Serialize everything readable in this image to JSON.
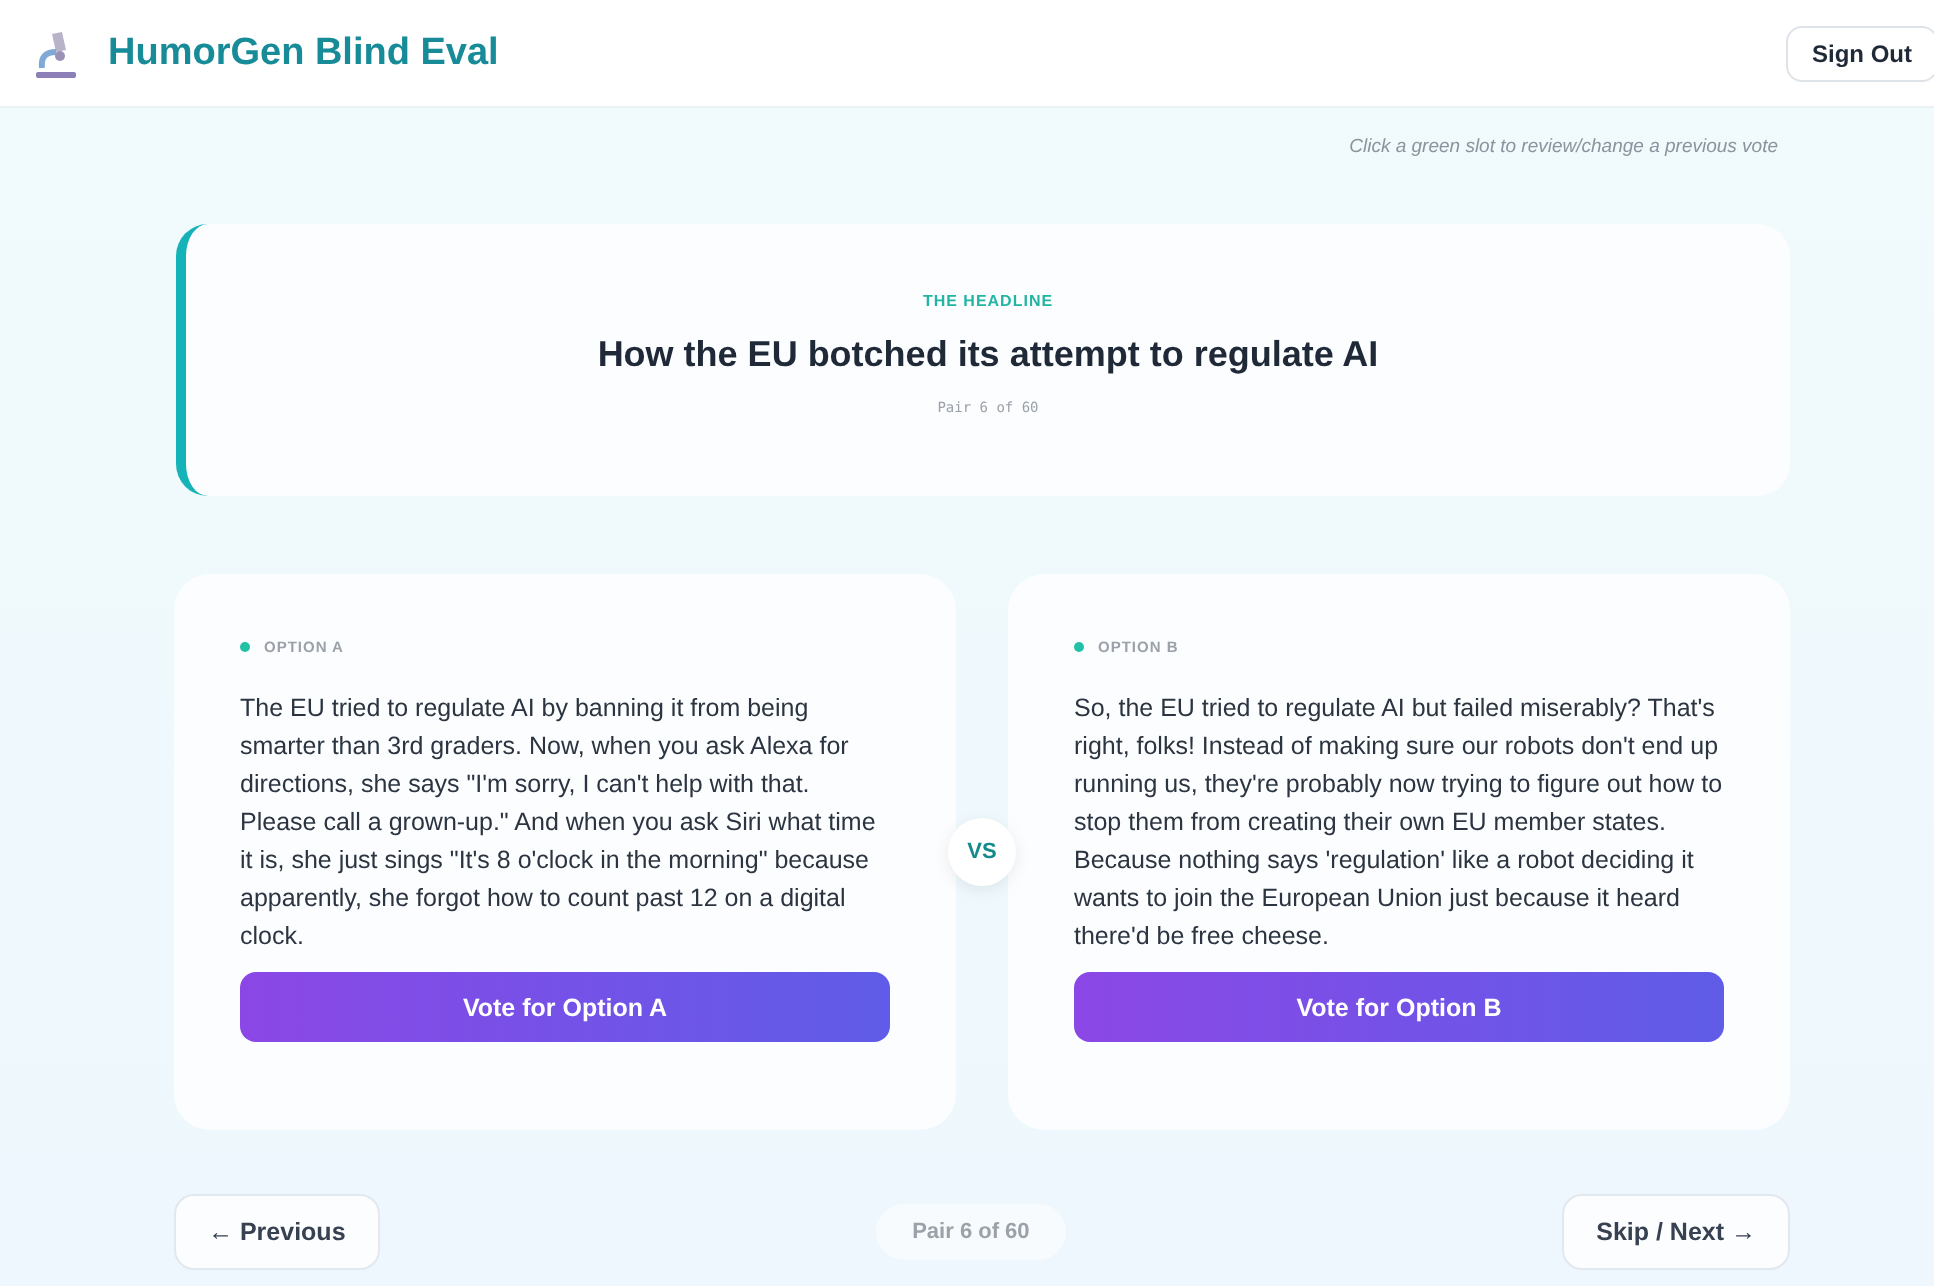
{
  "header": {
    "title": "HumorGen Blind Eval",
    "sign_out": "Sign Out"
  },
  "hint": "Click a green slot to review/change a previous vote",
  "headline": {
    "label": "THE HEADLINE",
    "title": "How the EU botched its attempt to regulate AI",
    "pair": "Pair 6 of 60"
  },
  "options": [
    {
      "label": "OPTION A",
      "text": "The EU tried to regulate AI by banning it from being smarter than 3rd graders. Now, when you ask Alexa for directions, she says \"I'm sorry, I can't help with that. Please call a grown-up.\" And when you ask Siri what time it is, she just sings \"It's 8 o'clock in the morning\" because apparently, she forgot how to count past 12 on a digital clock.",
      "button": "Vote for Option A"
    },
    {
      "label": "OPTION B",
      "text": "So, the EU tried to regulate AI but failed miserably? That's right, folks! Instead of making sure our robots don't end up running us, they're probably now trying to figure out how to stop them from creating their own EU member states. Because nothing says 'regulation' like a robot deciding it wants to join the European Union just because it heard there'd be free cheese.",
      "button": "Vote for Option B"
    }
  ],
  "vs": "VS",
  "nav": {
    "previous": "← Previous",
    "counter": "Pair 6 of 60",
    "next": "Skip / Next →"
  }
}
